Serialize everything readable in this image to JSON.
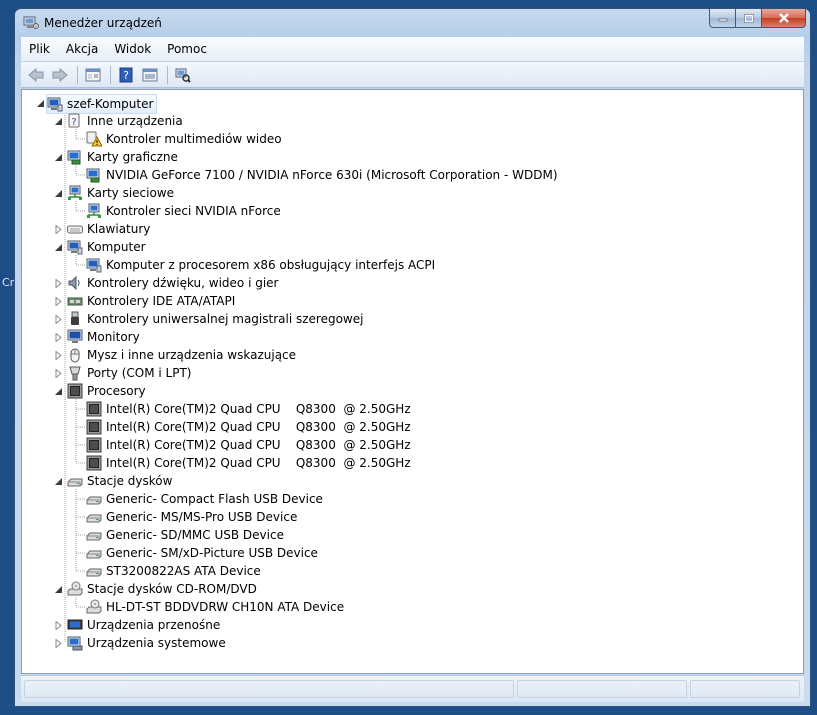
{
  "desktop": {
    "edge_text": "Cr"
  },
  "window": {
    "title": "Menedżer urządzeń"
  },
  "menu": [
    "Plik",
    "Akcja",
    "Widok",
    "Pomoc"
  ],
  "toolbar": [
    "back-icon",
    "forward-icon",
    "properties-icon",
    "help-icon",
    "action-view-icon",
    "scan-hardware-icon"
  ],
  "tree": {
    "root": "szef-Komputer",
    "categories": [
      {
        "label": "Inne urządzenia",
        "icon": "unknown-device-icon",
        "expanded": true,
        "children": [
          {
            "label": "Kontroler multimediów wideo",
            "icon": "warning-device-icon"
          }
        ]
      },
      {
        "label": "Karty graficzne",
        "icon": "display-adapter-icon",
        "expanded": true,
        "children": [
          {
            "label": "NVIDIA GeForce 7100 / NVIDIA nForce 630i (Microsoft Corporation - WDDM)",
            "icon": "display-adapter-icon"
          }
        ]
      },
      {
        "label": "Karty sieciowe",
        "icon": "network-adapter-icon",
        "expanded": true,
        "children": [
          {
            "label": "Kontroler sieci NVIDIA nForce",
            "icon": "network-adapter-icon"
          }
        ]
      },
      {
        "label": "Klawiatury",
        "icon": "keyboard-icon",
        "expanded": false,
        "children": []
      },
      {
        "label": "Komputer",
        "icon": "computer-icon",
        "expanded": true,
        "children": [
          {
            "label": "Komputer z procesorem x86 obsługujący interfejs ACPI",
            "icon": "computer-icon"
          }
        ]
      },
      {
        "label": "Kontrolery dźwięku, wideo i gier",
        "icon": "speaker-icon",
        "expanded": false,
        "children": []
      },
      {
        "label": "Kontrolery IDE ATA/ATAPI",
        "icon": "ide-controller-icon",
        "expanded": false,
        "children": []
      },
      {
        "label": "Kontrolery uniwersalnej magistrali szeregowej",
        "icon": "usb-icon",
        "expanded": false,
        "children": []
      },
      {
        "label": "Monitory",
        "icon": "monitor-icon",
        "expanded": false,
        "children": []
      },
      {
        "label": "Mysz i inne urządzenia wskazujące",
        "icon": "mouse-icon",
        "expanded": false,
        "children": []
      },
      {
        "label": "Porty (COM i LPT)",
        "icon": "port-icon",
        "expanded": false,
        "children": []
      },
      {
        "label": "Procesory",
        "icon": "processor-icon",
        "expanded": true,
        "children": [
          {
            "label": "Intel(R) Core(TM)2 Quad CPU    Q8300  @ 2.50GHz",
            "icon": "processor-icon"
          },
          {
            "label": "Intel(R) Core(TM)2 Quad CPU    Q8300  @ 2.50GHz",
            "icon": "processor-icon"
          },
          {
            "label": "Intel(R) Core(TM)2 Quad CPU    Q8300  @ 2.50GHz",
            "icon": "processor-icon"
          },
          {
            "label": "Intel(R) Core(TM)2 Quad CPU    Q8300  @ 2.50GHz",
            "icon": "processor-icon"
          }
        ]
      },
      {
        "label": "Stacje dysków",
        "icon": "disk-drive-icon",
        "expanded": true,
        "children": [
          {
            "label": "Generic- Compact Flash USB Device",
            "icon": "disk-drive-icon"
          },
          {
            "label": "Generic- MS/MS-Pro USB Device",
            "icon": "disk-drive-icon"
          },
          {
            "label": "Generic- SD/MMC USB Device",
            "icon": "disk-drive-icon"
          },
          {
            "label": "Generic- SM/xD-Picture USB Device",
            "icon": "disk-drive-icon"
          },
          {
            "label": "ST3200822AS ATA Device",
            "icon": "disk-drive-icon"
          }
        ]
      },
      {
        "label": "Stacje dysków CD-ROM/DVD",
        "icon": "cdrom-icon",
        "expanded": true,
        "children": [
          {
            "label": "HL-DT-ST BDDVDRW CH10N ATA Device",
            "icon": "cdrom-icon"
          }
        ]
      },
      {
        "label": "Urządzenia przenośne",
        "icon": "portable-device-icon",
        "expanded": false,
        "children": []
      },
      {
        "label": "Urządzenia systemowe",
        "icon": "system-device-icon",
        "expanded": false,
        "children": []
      }
    ]
  },
  "colors": {
    "accent": "#3399ff",
    "tree_line": "#a0a0a0",
    "chrome": "#c6d9ee"
  }
}
